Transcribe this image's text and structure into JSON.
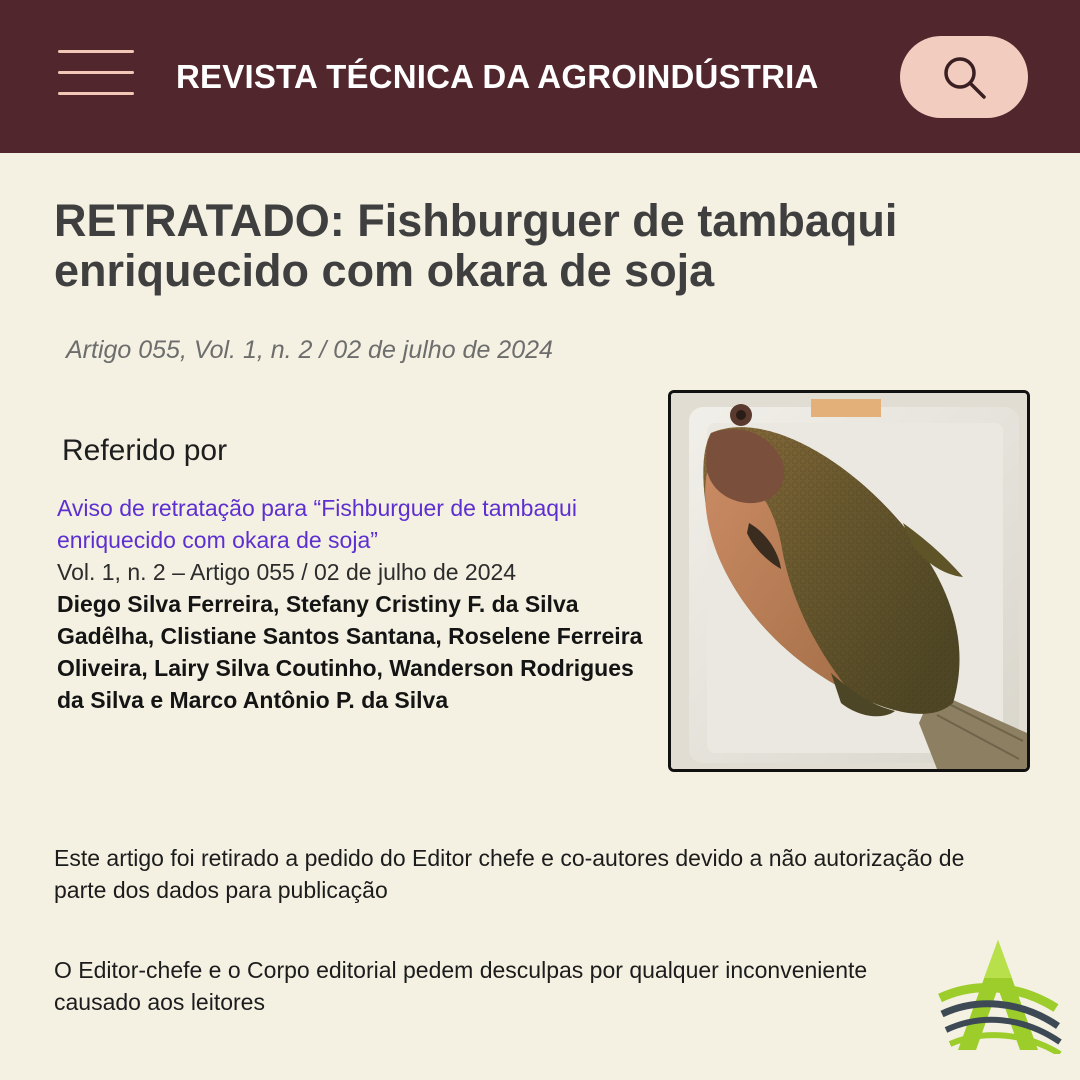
{
  "header": {
    "title": "REVISTA TÉCNICA DA AGROINDÚSTRIA",
    "menu_icon": "hamburger-menu-icon",
    "search_icon": "search-icon",
    "background": "#52262d",
    "accent": "#f2cdbf"
  },
  "article": {
    "title": "RETRATADO: Fishburguer de tambaqui enriquecido com okara de soja",
    "meta": "Artigo 055, Vol. 1, n. 2 / 02 de julho de 2024"
  },
  "referenced_by": {
    "label": "Referido por",
    "link": "Aviso de retratação para “Fishburguer de tambaqui enriquecido com okara de soja”",
    "detail": "Vol. 1, n. 2 – Artigo 055 / 02 de julho de 2024",
    "authors": "Diego Silva Ferreira, Stefany Cristiny F. da Silva Gadêlha, Clistiane Santos Santana, Roselene Ferreira Oliveira, Lairy Silva Coutinho, Wanderson Rodrigues da Silva e Marco Antônio P. da Silva"
  },
  "image": {
    "subject": "tambaqui fish on a white tray"
  },
  "notices": {
    "retraction_reason": "Este artigo foi retirado a pedido do Editor chefe e co-autores devido a não autorização de parte dos dados para publicação",
    "apology": "O Editor-chefe e o Corpo editorial pedem desculpas por qualquer inconveniente causado aos leitores"
  },
  "logo": {
    "icon": "journal-logo-icon",
    "colors": [
      "#9ccd2a",
      "#3d4a55"
    ]
  }
}
